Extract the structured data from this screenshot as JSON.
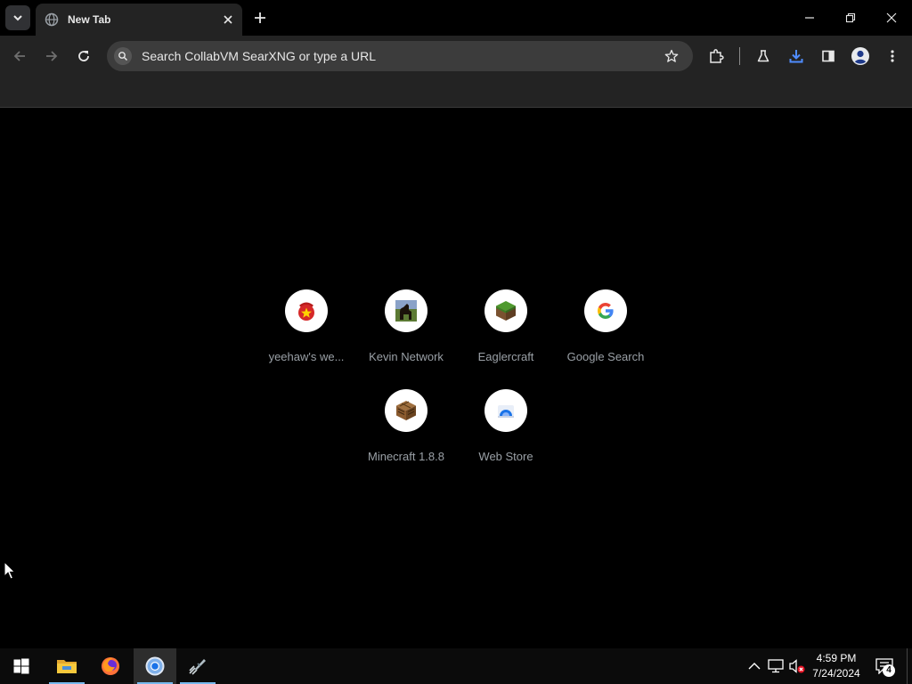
{
  "window": {
    "tab_title": "New Tab",
    "controls": [
      "minimize",
      "restore",
      "close"
    ]
  },
  "toolbar": {
    "omnibox_placeholder": "Search CollabVM SearXNG or type a URL",
    "icons": [
      "back-icon",
      "forward-icon",
      "reload-icon",
      "star-icon",
      "extensions-icon",
      "labs-icon",
      "download-icon",
      "side-panel-icon",
      "profile-icon",
      "menu-icon"
    ],
    "download_color": "#4f8cff"
  },
  "shortcuts": [
    {
      "label": "yeehaw's we...",
      "icon": "yeehaw-icon"
    },
    {
      "label": "Kevin Network",
      "icon": "horse-icon"
    },
    {
      "label": "Eaglercraft",
      "icon": "grass-block-icon"
    },
    {
      "label": "Google Search",
      "icon": "google-icon"
    },
    {
      "label": "Minecraft 1.8.8",
      "icon": "crafting-table-icon"
    },
    {
      "label": "Web Store",
      "icon": "web-store-icon"
    }
  ],
  "taskbar": {
    "apps": [
      "start-icon",
      "file-explorer-icon",
      "firefox-icon",
      "chrome-icon",
      "app-icon"
    ],
    "active_app": "chrome-icon",
    "clock_time": "4:59 PM",
    "clock_date": "7/24/2024",
    "notification_count": "4"
  }
}
